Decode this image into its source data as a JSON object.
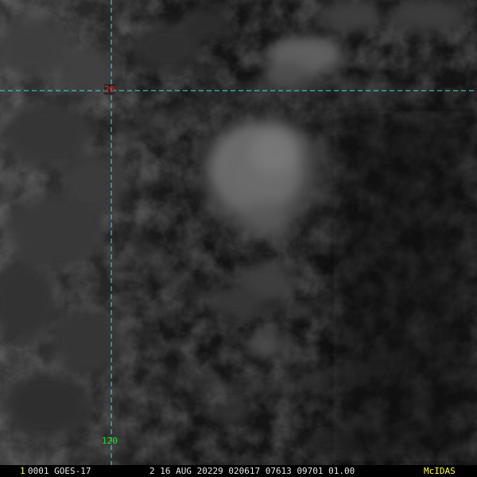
{
  "graticule": {
    "latitude_label": "20",
    "longitude_label": "120",
    "line_color": "#33e0e0"
  },
  "status_bar": {
    "frame_number": "1",
    "satellite": "0001 GOES-17",
    "date_time": "2 16 AUG 20229 020617 07613 09701 01.00",
    "logo_text": "McIDAS"
  },
  "colors": {
    "background": "#121212",
    "cloud_bright": "#9a9a9a",
    "latitude_label": "#ff2020",
    "longitude_label": "#22dd22",
    "status_highlight": "#ffff40"
  }
}
